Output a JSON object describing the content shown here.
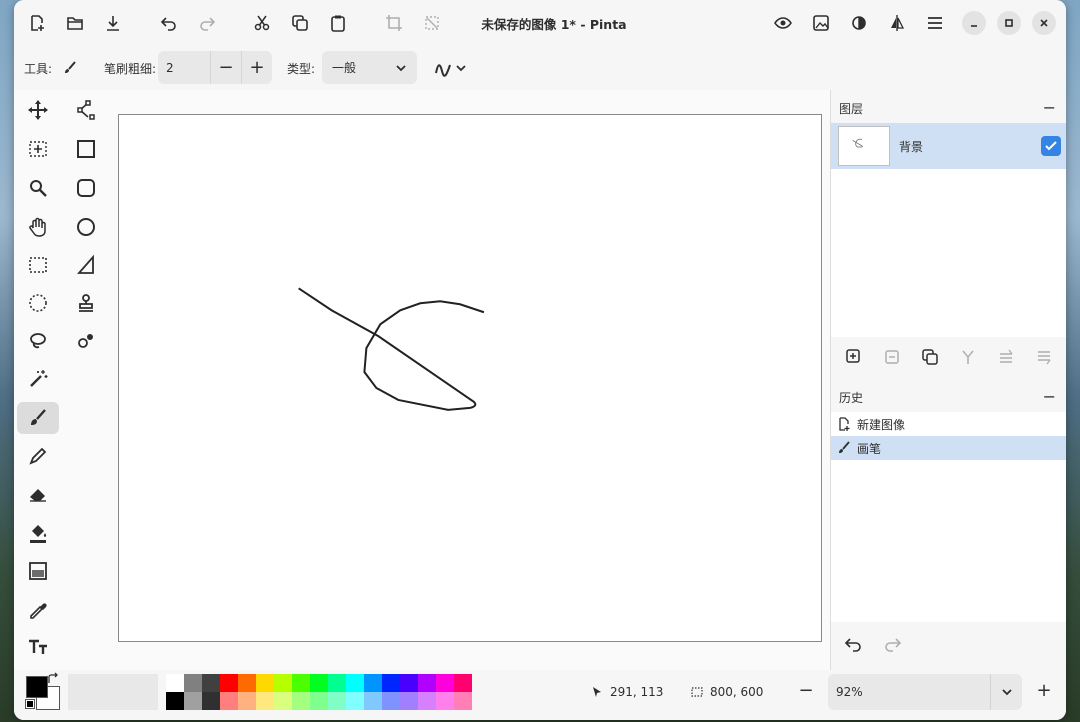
{
  "window": {
    "title": "未保存的图像 1* - Pinta"
  },
  "toolbar": {
    "tool_label": "工具:",
    "brush_width_label": "笔刷粗细:",
    "brush_width_value": "2",
    "minus": "−",
    "plus": "+",
    "type_label": "类型:",
    "type_value": "一般"
  },
  "layers_panel": {
    "title": "图层",
    "collapse": "−",
    "layers": [
      {
        "name": "背景",
        "visible": true
      }
    ]
  },
  "history_panel": {
    "title": "历史",
    "collapse": "−",
    "items": [
      {
        "label": "新建图像",
        "icon": "new-image-icon",
        "active": false
      },
      {
        "label": "画笔",
        "icon": "paintbrush-icon",
        "active": true
      }
    ]
  },
  "status": {
    "cursor_position": "291, 113",
    "selection_size": "800, 600",
    "zoom": "92%",
    "zoom_out": "−",
    "zoom_in": "+"
  },
  "palette": {
    "row1": [
      "#ffffff",
      "#808080",
      "#404040",
      "#ff0000",
      "#ff6a00",
      "#ffd800",
      "#b6ff00",
      "#4cff00",
      "#00ff21",
      "#00ff90",
      "#00ffff",
      "#0094ff",
      "#0026ff",
      "#4800ff",
      "#b200ff",
      "#ff00dc",
      "#ff006e"
    ],
    "row2": [
      "#000000",
      "#a0a0a0",
      "#303030",
      "#ff7f7f",
      "#ffb27f",
      "#ffe97f",
      "#daff7f",
      "#a5ff7f",
      "#7fff8e",
      "#7fffc5",
      "#7fffff",
      "#7fc9ff",
      "#7f92ff",
      "#a17fff",
      "#d67fff",
      "#ff7fed",
      "#ff7fb6"
    ]
  },
  "colors": {
    "accent": "#3584e4",
    "selection": "#cfe0f4"
  }
}
